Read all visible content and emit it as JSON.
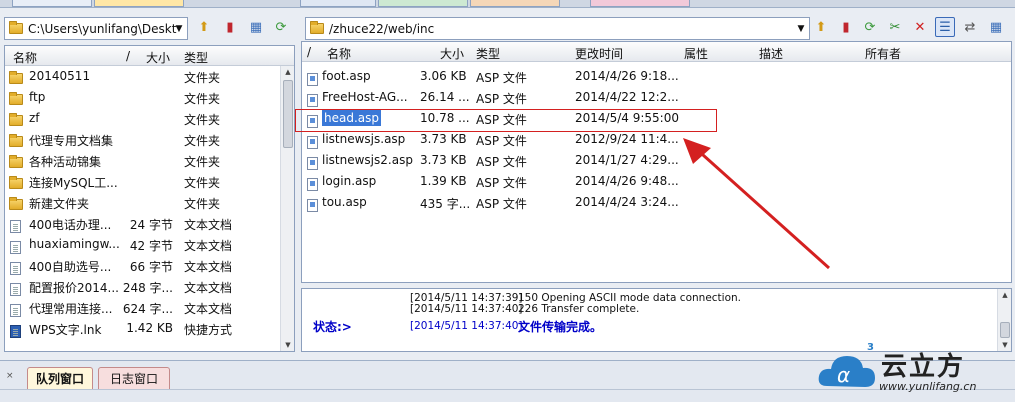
{
  "left_pane": {
    "path": "C:\\Users\\yunlifang\\Deskt",
    "columns": {
      "name": "名称",
      "sep": "/",
      "size": "大小",
      "type": "类型"
    },
    "rows": [
      {
        "name": "20140511",
        "size": "",
        "type": "文件夹",
        "icon": "folder-icon"
      },
      {
        "name": "ftp",
        "size": "",
        "type": "文件夹",
        "icon": "folder-icon"
      },
      {
        "name": "zf",
        "size": "",
        "type": "文件夹",
        "icon": "folder-icon"
      },
      {
        "name": "代理专用文档集",
        "size": "",
        "type": "文件夹",
        "icon": "folder-icon"
      },
      {
        "name": "各种活动锦集",
        "size": "",
        "type": "文件夹",
        "icon": "folder-icon"
      },
      {
        "name": "连接MySQL工...",
        "size": "",
        "type": "文件夹",
        "icon": "folder-icon"
      },
      {
        "name": "新建文件夹",
        "size": "",
        "type": "文件夹",
        "icon": "folder-icon"
      },
      {
        "name": "400电话办理...",
        "size": "24 字节",
        "type": "文本文档",
        "icon": "text-file-icon"
      },
      {
        "name": "huaxiamingw...",
        "size": "42 字节",
        "type": "文本文档",
        "icon": "text-file-icon"
      },
      {
        "name": "400自助选号...",
        "size": "66 字节",
        "type": "文本文档",
        "icon": "text-file-icon"
      },
      {
        "name": "配置报价2014...",
        "size": "248 字...",
        "type": "文本文档",
        "icon": "text-file-icon"
      },
      {
        "name": "代理常用连接...",
        "size": "624 字...",
        "type": "文本文档",
        "icon": "text-file-icon"
      },
      {
        "name": "WPS文字.lnk",
        "size": "1.42 KB",
        "type": "快捷方式",
        "icon": "shortcut-icon"
      }
    ]
  },
  "right_pane": {
    "path": "/zhuce22/web/inc",
    "columns": {
      "sep": "/",
      "name": "名称",
      "size": "大小",
      "type": "类型",
      "modified": "更改时间",
      "attr": "属性",
      "desc": "描述",
      "owner": "所有者"
    },
    "rows": [
      {
        "name": "foot.asp",
        "size": "3.06 KB",
        "type": "ASP 文件",
        "modified": "2014/4/26 9:18..."
      },
      {
        "name": "FreeHost-AG...",
        "size": "26.14 ...",
        "type": "ASP 文件",
        "modified": "2014/4/22 12:2..."
      },
      {
        "name": "head.asp",
        "size": "10.78 ...",
        "type": "ASP 文件",
        "modified": "2014/5/4 9:55:00"
      },
      {
        "name": "listnewsjs.asp",
        "size": "3.73 KB",
        "type": "ASP 文件",
        "modified": "2012/9/24 11:4..."
      },
      {
        "name": "listnewsjs2.asp",
        "size": "3.73 KB",
        "type": "ASP 文件",
        "modified": "2014/1/27 4:29..."
      },
      {
        "name": "login.asp",
        "size": "1.39 KB",
        "type": "ASP 文件",
        "modified": "2014/4/26 9:48..."
      },
      {
        "name": "tou.asp",
        "size": "435 字...",
        "type": "ASP 文件",
        "modified": "2014/4/24 3:24..."
      }
    ],
    "selected_index": 2
  },
  "log": {
    "lines": [
      {
        "time": "[2014/5/11 14:37:39]",
        "msg": "150 Opening ASCII mode data connection."
      },
      {
        "time": "[2014/5/11 14:37:40]",
        "msg": "226 Transfer complete."
      }
    ],
    "status_label": "状态:>",
    "status_time": "[2014/5/11 14:37:40]",
    "status_msg": "文件传输完成。"
  },
  "bottom_tabs": {
    "queue": "队列窗口",
    "log": "日志窗口"
  },
  "watermark": {
    "brand": "云立方",
    "url": "www.yunlifang.cn",
    "mark": "3"
  },
  "colors": {
    "selection": "#3a78d7",
    "annotation": "#d42020",
    "status_text": "#0000c8"
  }
}
